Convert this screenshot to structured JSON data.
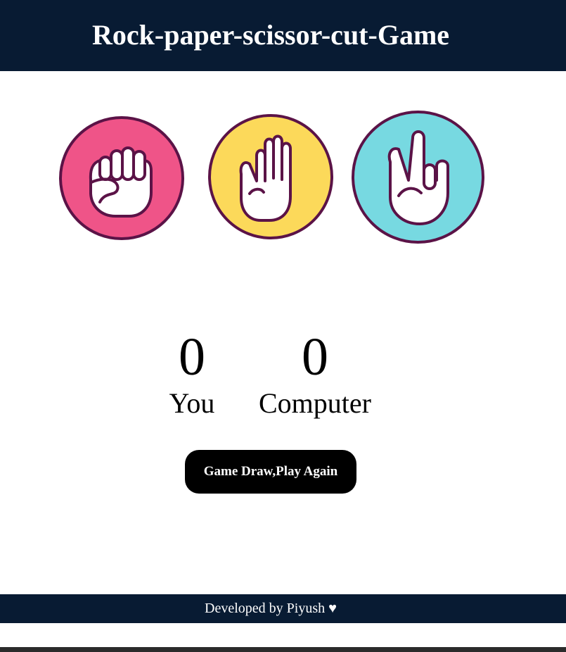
{
  "header": {
    "title": "Rock-paper-scissor-cut-Game"
  },
  "choices": [
    {
      "icon": "rock-hand-icon",
      "color": "#ef5488"
    },
    {
      "icon": "paper-hand-icon",
      "color": "#fcd95a"
    },
    {
      "icon": "scissors-hand-icon",
      "color": "#77d9e1"
    }
  ],
  "colors": {
    "outline": "#5b1347",
    "header_bg": "#081b33",
    "button_bg": "#000000"
  },
  "scoreboard": {
    "user_score": "0",
    "user_label": "You",
    "computer_score": "0",
    "computer_label": "Computer"
  },
  "message": {
    "text": "Game Draw,Play Again"
  },
  "footer": {
    "text": "Developed by Piyush ♥"
  }
}
